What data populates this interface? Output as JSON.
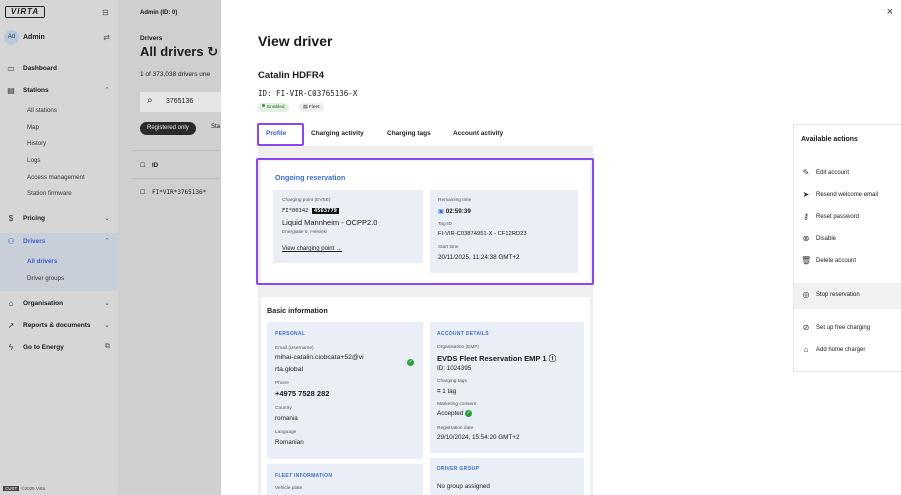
{
  "app": {
    "logo_text": "VIRTA",
    "footer_badge": "CUST",
    "footer_text": "©2025 Virta"
  },
  "user": {
    "avatar": "Ad",
    "name": "Admin"
  },
  "sidebar": {
    "items": [
      {
        "label": "Dashboard",
        "icon": "dashboard-icon"
      },
      {
        "label": "Stations",
        "icon": "stations-icon"
      },
      {
        "label": "Pricing",
        "icon": "pricing-icon"
      },
      {
        "label": "Drivers",
        "icon": "drivers-icon"
      },
      {
        "label": "Organisation",
        "icon": "organisation-icon"
      },
      {
        "label": "Reports & documents",
        "icon": "reports-icon"
      },
      {
        "label": "Go to Energy",
        "icon": "energy-icon"
      }
    ],
    "stations_sub": [
      "All stations",
      "Map",
      "History",
      "Logs",
      "Access management",
      "Station firmware"
    ],
    "drivers_sub": [
      "All drivers",
      "Driver groups"
    ]
  },
  "background": {
    "breadcrumb": "Admin (ID: 0)",
    "section": "Drivers",
    "title": "All drivers",
    "count": "1 of 373,038 drivers une",
    "search_value": "3765136",
    "filter_chip": "Registered only",
    "filter_chip2": "Sta",
    "column_id": "ID",
    "row_id": "FI*VIR*3765136*"
  },
  "modal": {
    "title": "View driver",
    "close": "×",
    "driver_name": "Catalin HDFR4",
    "driver_id": "ID: FI-VIR-C03765136-X",
    "badge_enabled": "Enabled",
    "badge_fleet": "Fleet",
    "tabs": [
      "Profile",
      "Charging activity",
      "Charging tags",
      "Account activity"
    ]
  },
  "reservation": {
    "title": "Ongoing reservation",
    "cp_label": "Charging point (EVSE)",
    "cp_id_prefix": "FI*00142",
    "cp_id_tag": "4563779",
    "cp_name": "Liquid Mannheim - OCPP2.0",
    "cp_address": "Energiatie 6, Helsinki",
    "cp_link": "View charging point →",
    "remaining_label": "Remaining time",
    "remaining_value": "02:59:39",
    "tag_label": "Tag ID",
    "tag_value": "FI-VIR-C03874951-X - CF12RD23",
    "start_label": "Start time",
    "start_value": "20/11/2025, 11:24:38 GMT+2"
  },
  "basic": {
    "title": "Basic information",
    "personal_head": "PERSONAL",
    "email_label": "Email (Username)",
    "email_line1": "mihai-catalin.ciobcata+52@vi",
    "email_line2": "rta.global",
    "phone_label": "Phone",
    "phone_value": "+4975 7528 282",
    "country_label": "Country",
    "country_value": "romania",
    "language_label": "Language",
    "language_value": "Romanian",
    "account_head": "ACCOUNT DETAILS",
    "org_label": "Organisation (EMP)",
    "org_value": "EVDS Fleet Reservation EMP 1 ⓘ",
    "org_id": "ID: 1024395",
    "tags_label": "Charging tags",
    "tags_value": "1 tag",
    "marketing_label": "Marketing consent",
    "marketing_value": "Accepted",
    "reg_label": "Registration date",
    "reg_value": "29/10/2024, 15:54:20 GMT+2",
    "fleet_head": "FLEET INFORMATION",
    "fleet_label": "Vehicle plate",
    "group_head": "DRIVER GROUP",
    "group_value": "No group assigned"
  },
  "actions": {
    "title": "Available actions",
    "items": [
      {
        "label": "Edit account",
        "icon": "edit-icon"
      },
      {
        "label": "Resend welcome email",
        "icon": "send-icon"
      },
      {
        "label": "Reset password",
        "icon": "key-icon"
      },
      {
        "label": "Disable",
        "icon": "disable-icon"
      },
      {
        "label": "Delete account",
        "icon": "trash-icon"
      },
      {
        "label": "Stop reservation",
        "icon": "stop-icon"
      },
      {
        "label": "Set up free charging",
        "icon": "free-charging-icon"
      },
      {
        "label": "Add home charger",
        "icon": "home-charger-icon"
      }
    ]
  },
  "colors": {
    "accent": "#3a5bd0",
    "highlight": "#8a46f0",
    "success": "#2f9b3c",
    "sidebar_bg": "#d6d6d6"
  }
}
